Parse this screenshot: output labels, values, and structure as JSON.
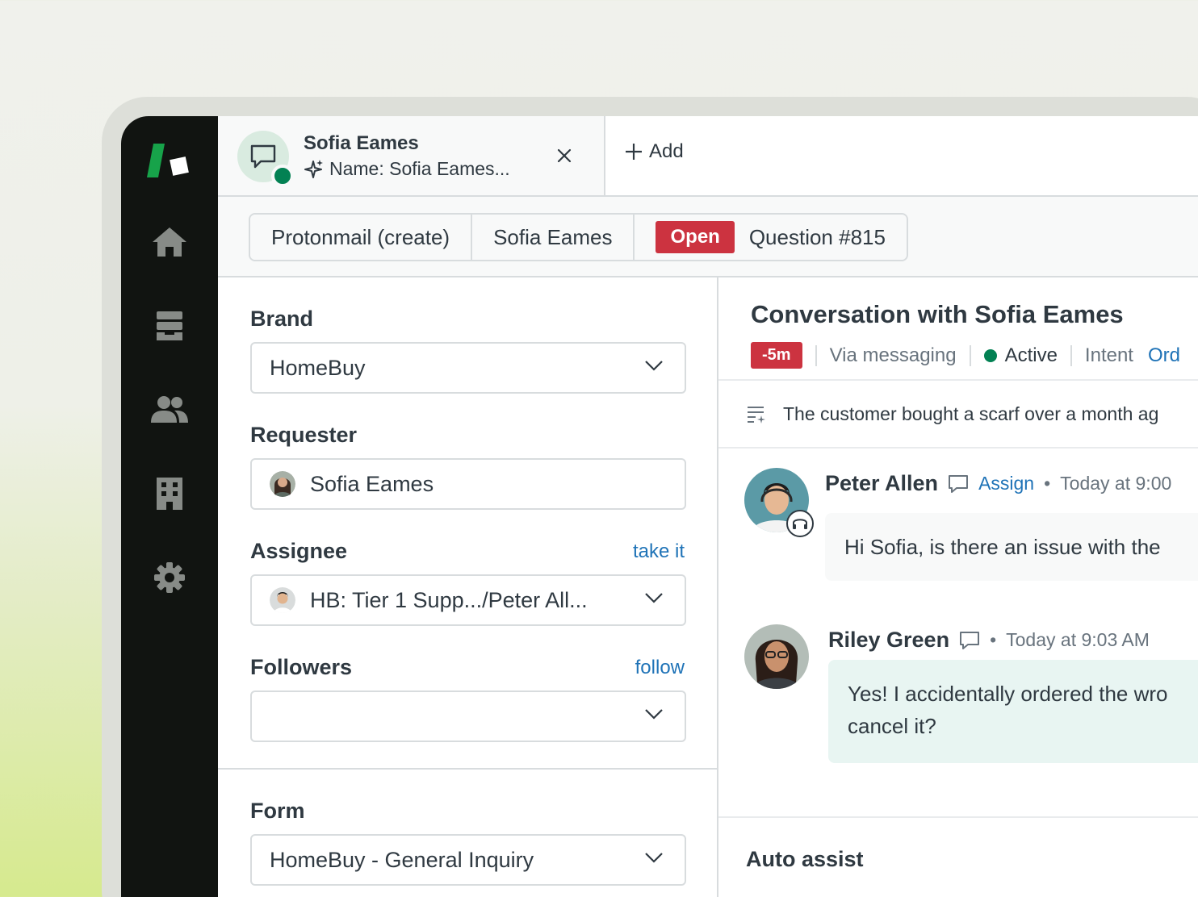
{
  "tab": {
    "title": "Sofia Eames",
    "subtitle": "Name: Sofia Eames...",
    "add_label": "Add"
  },
  "breadcrumbs": [
    {
      "label": "Protonmail (create)"
    },
    {
      "label": "Sofia Eames"
    },
    {
      "status": "Open",
      "label": "Question #815"
    }
  ],
  "fields": {
    "brand": {
      "label": "Brand",
      "value": "HomeBuy"
    },
    "requester": {
      "label": "Requester",
      "value": "Sofia Eames"
    },
    "assignee": {
      "label": "Assignee",
      "link": "take it",
      "value": "HB: Tier 1 Supp.../Peter All..."
    },
    "followers": {
      "label": "Followers",
      "link": "follow",
      "value": ""
    },
    "form": {
      "label": "Form",
      "value": "HomeBuy - General Inquiry"
    }
  },
  "conversation": {
    "title": "Conversation with Sofia Eames",
    "sla": "-5m",
    "via": "Via messaging",
    "status": "Active",
    "intent_label": "Intent",
    "intent_value": "Ord",
    "summary": "The customer bought a scarf over a month ag",
    "messages": [
      {
        "author": "Peter Allen",
        "action": "Assign",
        "time": "Today at 9:00",
        "text": "Hi Sofia, is there an issue with the"
      },
      {
        "author": "Riley Green",
        "time": "Today at 9:03 AM",
        "text_line1": "Yes! I accidentally ordered the wro",
        "text_line2": "cancel it?"
      }
    ],
    "auto_assist": "Auto assist"
  },
  "colors": {
    "nav_bg": "#111411",
    "brand_green": "#17a34a",
    "danger": "#cc3340",
    "link": "#1f73b7",
    "online": "#038153",
    "bubble_customer": "#e8f5f2",
    "bubble_agent": "#f8f9f9"
  },
  "icons": [
    "zendesk-logo",
    "home-icon",
    "views-icon",
    "customers-icon",
    "organizations-icon",
    "settings-icon",
    "chat-icon",
    "ai-sparkle-icon",
    "close-icon",
    "plus-icon",
    "chevron-down-icon",
    "summary-icon",
    "comment-icon",
    "headset-icon"
  ]
}
